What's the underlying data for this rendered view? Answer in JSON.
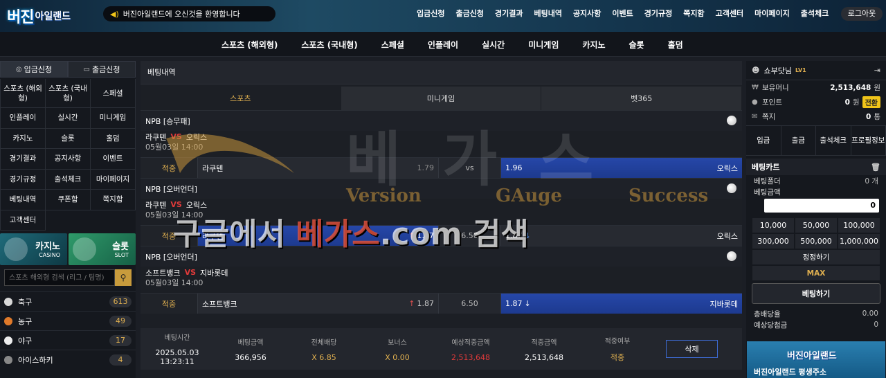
{
  "header": {
    "logo_a": "버진",
    "logo_b": "아일랜드",
    "notice": "버진아일랜드에 오신것을 환영합니다",
    "nav": [
      "입금신청",
      "출금신청",
      "경기결과",
      "베팅내역",
      "공지사항",
      "이벤트",
      "경기규정",
      "쪽지함",
      "고객센터",
      "마이페이지",
      "출석체크"
    ],
    "logout": "로그아웃"
  },
  "mainnav": [
    "스포츠 (해외형)",
    "스포츠 (국내형)",
    "스페셜",
    "인플레이",
    "실시간",
    "미니게임",
    "카지노",
    "슬롯",
    "홀덤"
  ],
  "left": {
    "deposit": "입금신청",
    "withdraw": "출금신청",
    "grid_tall": [
      "스포츠 (해외형)",
      "스포츠 (국내형)",
      "스페셜"
    ],
    "grid": [
      "인플레이",
      "실시간",
      "미니게임",
      "카지노",
      "슬롯",
      "홀덤",
      "경기결과",
      "공지사항",
      "이벤트",
      "경기규정",
      "출석체크",
      "마이페이지",
      "베팅내역",
      "쿠폰함",
      "쪽지함",
      "고객센터"
    ],
    "casino_title": "카지노",
    "casino_sub": "CASINO",
    "slot_title": "슬롯",
    "slot_sub": "SLOT",
    "search_placeholder": "스포츠 해외형 검색 (리그 / 팀명)",
    "sports": [
      {
        "name": "축구",
        "count": "613",
        "color": "#d8d8d8"
      },
      {
        "name": "농구",
        "count": "49",
        "color": "#e07a2a"
      },
      {
        "name": "야구",
        "count": "17",
        "color": "#eeeeee"
      },
      {
        "name": "아이스하키",
        "count": "4",
        "color": "#888888"
      }
    ]
  },
  "center": {
    "title": "베팅내역",
    "tabs": [
      "스포츠",
      "미니게임",
      "벳365"
    ],
    "games": [
      {
        "league": "NPB [승무패]",
        "home": "라쿠텐",
        "vs": "VS",
        "away": "오릭스",
        "date": "05월03일 14:00",
        "label": "적중",
        "home_name": "라쿠텐",
        "home_odds": "1.79",
        "mid": "vs",
        "away_odds": "1.96",
        "away_name": "오릭스"
      },
      {
        "league": "NPB [오버언더]",
        "home": "라쿠텐",
        "vs": "VS",
        "away": "오릭스",
        "date": "05월03일 14:00",
        "label": "적중",
        "home_name": "라쿠텐",
        "home_odds": "1.87",
        "mid": "6.50",
        "away_odds": "1.87",
        "away_name": "오릭스"
      },
      {
        "league": "NPB [오버언더]",
        "home": "소프트뱅크",
        "vs": "VS",
        "away": "지바롯데",
        "date": "05월03일 14:00",
        "label": "적중",
        "home_name": "소프트뱅크",
        "home_odds": "1.87",
        "mid": "6.50",
        "away_odds": "1.87",
        "away_name": "지바롯데"
      }
    ],
    "summary": {
      "keys": [
        "베팅시간",
        "베팅금액",
        "전체배당",
        "보너스",
        "예상적중금액",
        "적중금액",
        "적중여부"
      ],
      "values": [
        "2025.05.03 13:23:11",
        "366,956",
        "X 6.85",
        "X 0.00",
        "2,513,648",
        "2,513,648",
        "적중"
      ],
      "delete": "삭제"
    }
  },
  "watermark": {
    "big": "베가스",
    "sub1": "Version",
    "sub2": "GAuge",
    "sub3": "Success",
    "line_a": "구글에서 ",
    "line_b": "베가스",
    "line_c": ".com 검색"
  },
  "right": {
    "user": "쇼부닷님",
    "level": "LV1",
    "money_label": "보유머니",
    "money": "2,513,648",
    "money_unit": "원",
    "point_label": "포인트",
    "point": "0",
    "point_unit": "원",
    "convert": "전환",
    "msg_label": "쪽지",
    "msg": "0",
    "msg_unit": "통",
    "quick": [
      "입금",
      "출금",
      "출석체크",
      "프로필정보"
    ],
    "cart_title": "베팅카트",
    "folder_label": "베팅폴더",
    "folder": "0 개",
    "amount_label": "베팅금액",
    "amount": "0",
    "chips": [
      "10,000",
      "50,000",
      "100,000",
      "300,000",
      "500,000",
      "1,000,000"
    ],
    "reset": "정정하기",
    "max": "MAX",
    "bet": "베팅하기",
    "total_odds_label": "총배당율",
    "total_odds": "0.00",
    "expected_label": "예상당첨금",
    "expected": "0",
    "ad_title": "버진아일랜드",
    "ad_sub": "버진아일랜드 평생주소"
  }
}
